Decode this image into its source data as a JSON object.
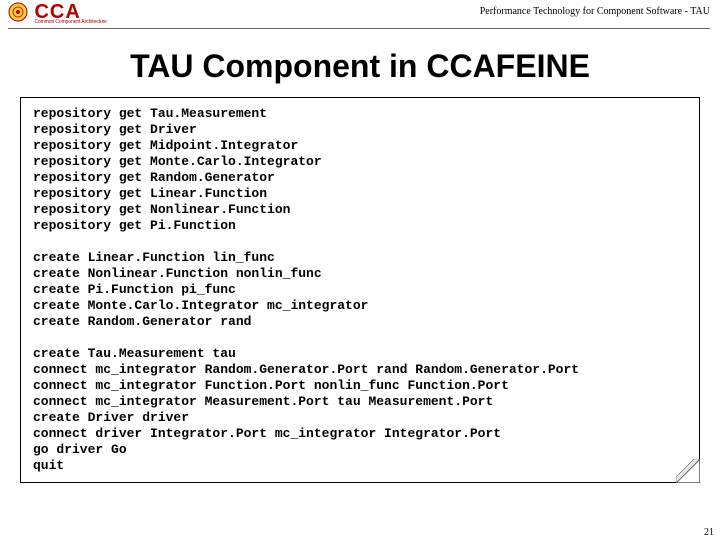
{
  "header": {
    "logo_main": "CCA",
    "logo_sub": "Common Component Architecture",
    "right_text": "Performance Technology for Component Software - TAU"
  },
  "title": "TAU Component in CCAFEINE",
  "code": {
    "block1": "repository get Tau.Measurement\nrepository get Driver\nrepository get Midpoint.Integrator\nrepository get Monte.Carlo.Integrator\nrepository get Random.Generator\nrepository get Linear.Function\nrepository get Nonlinear.Function\nrepository get Pi.Function",
    "block2": "create Linear.Function lin_func\ncreate Nonlinear.Function nonlin_func\ncreate Pi.Function pi_func\ncreate Monte.Carlo.Integrator mc_integrator\ncreate Random.Generator rand",
    "block3": "create Tau.Measurement tau\nconnect mc_integrator Random.Generator.Port rand Random.Generator.Port\nconnect mc_integrator Function.Port nonlin_func Function.Port\nconnect mc_integrator Measurement.Port tau Measurement.Port\ncreate Driver driver\nconnect driver Integrator.Port mc_integrator Integrator.Port\ngo driver Go\nquit"
  },
  "page_number": "21"
}
